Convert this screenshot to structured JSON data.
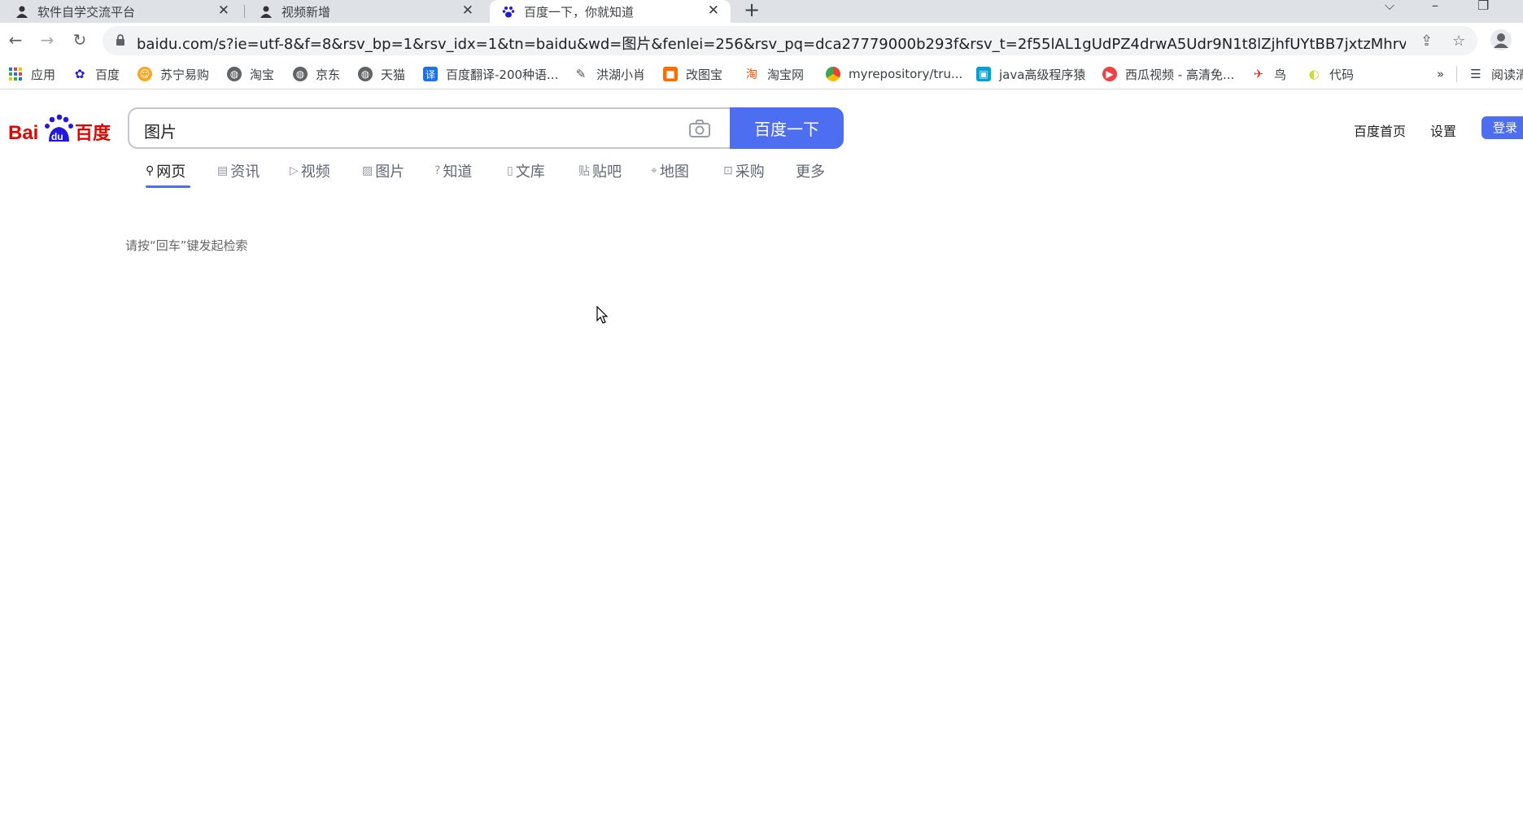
{
  "tabs": [
    {
      "title": "软件自学交流平台",
      "icon": "user-silhouette-icon"
    },
    {
      "title": "视频新增",
      "icon": "user-silhouette-icon"
    },
    {
      "title": "百度一下，你就知道",
      "icon": "baidu-paw-icon"
    }
  ],
  "address_bar": {
    "url": "baidu.com/s?ie=utf-8&f=8&rsv_bp=1&rsv_idx=1&tn=baidu&wd=图片&fenlei=256&rsv_pq=dca27779000b293f&rsv_t=2f55lAL1gUdPZ4drwA5Udr9N1t8lZjhfUYtBB7jxtzMhrvY76EnUGS..."
  },
  "bookmarks": {
    "apps_label": "应用",
    "items": [
      "百度",
      "苏宁易购",
      "淘宝",
      "京东",
      "天猫",
      "百度翻译-200种语...",
      "洪湖小肖",
      "改图宝",
      "淘宝网",
      "myrepository/tru...",
      "java高级程序猿",
      "西瓜视频 - 高清免...",
      "鸟",
      "代码"
    ],
    "more": "»",
    "reading_list": "阅读清"
  },
  "page": {
    "query": "图片",
    "search_button": "百度一下",
    "top_links": {
      "home": "百度首页",
      "settings": "设置",
      "login": "登录"
    },
    "search_tabs": [
      "网页",
      "资讯",
      "视频",
      "图片",
      "知道",
      "文库",
      "贴吧",
      "地图",
      "采购",
      "更多"
    ],
    "hint": "请按“回车”键发起检索"
  },
  "colors": {
    "accent": "#4e6ef2",
    "logo_red": "#e10601",
    "logo_blue": "#2319dc"
  }
}
